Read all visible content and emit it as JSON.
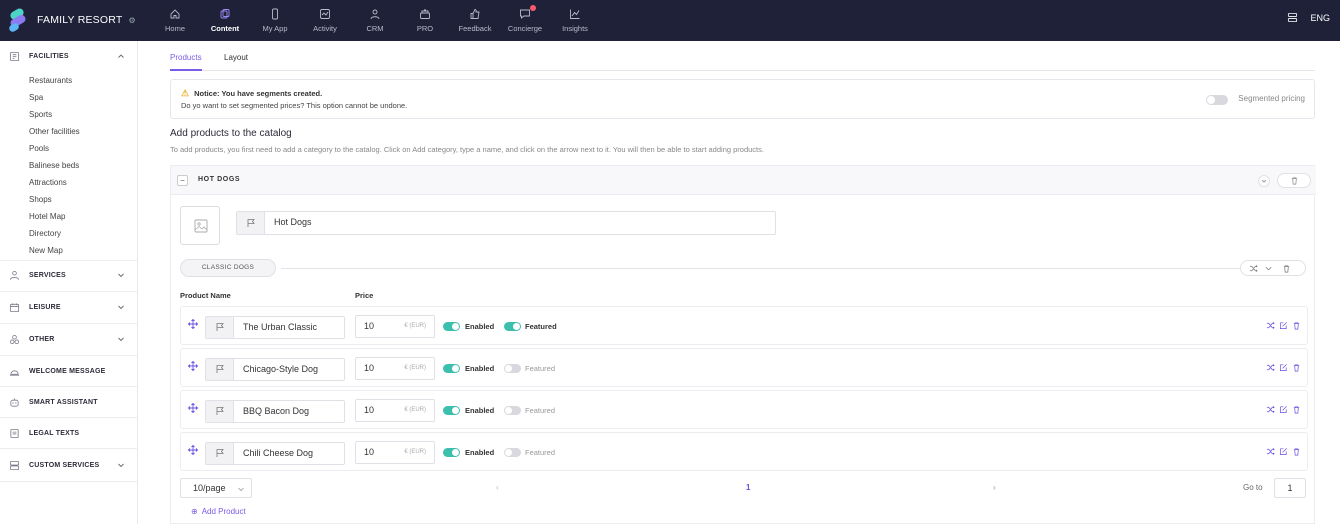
{
  "brand": {
    "name": "FAMILY RESORT",
    "menu_glyph": "⚙"
  },
  "nav": [
    {
      "label": "Home",
      "icon": "home-icon",
      "active": false
    },
    {
      "label": "Content",
      "icon": "content-icon",
      "active": true
    },
    {
      "label": "My App",
      "icon": "phone-icon",
      "active": false
    },
    {
      "label": "Activity",
      "icon": "activity-icon",
      "active": false
    },
    {
      "label": "CRM",
      "icon": "users-icon",
      "active": false
    },
    {
      "label": "PRO",
      "icon": "pro-icon",
      "active": false
    },
    {
      "label": "Feedback",
      "icon": "thumbs-up-icon",
      "active": false
    },
    {
      "label": "Concierge",
      "icon": "chat-icon",
      "active": false,
      "badge": true
    },
    {
      "label": "Insights",
      "icon": "chart-icon",
      "active": false
    }
  ],
  "top_right": {
    "language": "ENG"
  },
  "sidebar": {
    "facilities": {
      "label": "FACILITIES",
      "items": [
        "Restaurants",
        "Spa",
        "Sports",
        "Other facilities",
        "Pools",
        "Balinese beds",
        "Attractions",
        "Shops",
        "Hotel Map",
        "Directory",
        "New Map"
      ]
    },
    "sections": [
      {
        "label": "SERVICES",
        "icon": "services-icon",
        "chevron": true
      },
      {
        "label": "LEISURE",
        "icon": "calendar-icon",
        "chevron": true
      },
      {
        "label": "OTHER",
        "icon": "other-icon",
        "chevron": true
      },
      {
        "label": "WELCOME MESSAGE",
        "icon": "welcome-icon",
        "chevron": false
      },
      {
        "label": "SMART ASSISTANT",
        "icon": "assistant-icon",
        "chevron": false
      },
      {
        "label": "LEGAL TEXTS",
        "icon": "legal-icon",
        "chevron": false
      },
      {
        "label": "CUSTOM SERVICES",
        "icon": "custom-icon",
        "chevron": true
      }
    ]
  },
  "tabs": [
    "Products",
    "Layout"
  ],
  "notice": {
    "title": "Notice: You have segments created.",
    "text": "Do yo want to set segmented prices? This option cannot be undone.",
    "toggle_label": "Segmented pricing"
  },
  "catalog": {
    "title": "Add products to the catalog",
    "description": "To add products, you first need to add a category to the catalog. Click on Add category, type a name, and click on the arrow next to it. You will then be able to start adding products."
  },
  "category": {
    "collapse_glyph": "−",
    "name": "HOT DOGS",
    "name_input": "Hot Dogs",
    "subcategory": "CLASSIC DOGS"
  },
  "table": {
    "col_name": "Product Name",
    "col_price": "Price",
    "enabled_label": "Enabled",
    "featured_label": "Featured",
    "currency": "€ (EUR)",
    "rows": [
      {
        "name": "The Urban Classic",
        "price": "10",
        "enabled": true,
        "featured": true
      },
      {
        "name": "Chicago-Style Dog",
        "price": "10",
        "enabled": true,
        "featured": false
      },
      {
        "name": "BBQ Bacon Dog",
        "price": "10",
        "enabled": true,
        "featured": false
      },
      {
        "name": "Chili Cheese Dog",
        "price": "10",
        "enabled": true,
        "featured": false
      }
    ]
  },
  "pagination": {
    "per_page": "10/page",
    "prev": "‹",
    "current_page": "1",
    "next": "›",
    "goto_label": "Go to",
    "goto_value": "1"
  },
  "add_product": {
    "icon": "⊕",
    "label": "Add Product"
  },
  "colors": {
    "accent": "#7b5ce6",
    "toggle_on": "#3dbfae",
    "topbar": "#1f2139"
  }
}
